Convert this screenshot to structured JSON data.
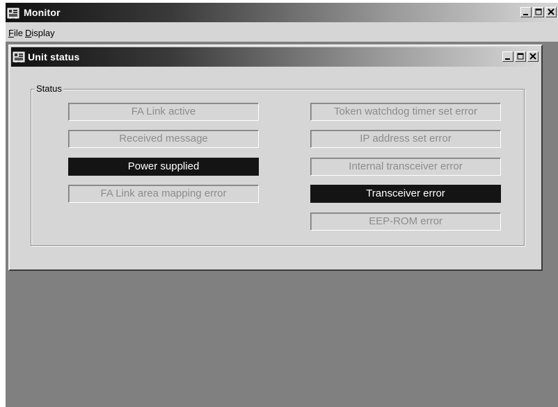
{
  "app": {
    "title": "Monitor"
  },
  "menu": {
    "items": [
      {
        "label": "File",
        "mnemonic": "F",
        "rest": "ile"
      },
      {
        "label": "Display",
        "mnemonic": "D",
        "rest": "isplay"
      }
    ]
  },
  "child_window": {
    "title": "Unit status"
  },
  "status_group": {
    "label": "Status",
    "left_column": [
      {
        "label": "FA Link active",
        "active": false
      },
      {
        "label": "Received message",
        "active": false
      },
      {
        "label": "Power supplied",
        "active": true
      },
      {
        "label": "FA Link area mapping error",
        "active": false
      }
    ],
    "right_column": [
      {
        "label": "Token watchdog timer set error",
        "active": false
      },
      {
        "label": "IP address set error",
        "active": false
      },
      {
        "label": "Internal transceiver error",
        "active": false
      },
      {
        "label": "Transceiver error",
        "active": true
      },
      {
        "label": "EEP-ROM error",
        "active": false
      }
    ]
  },
  "colors": {
    "active_bg": "#141414",
    "active_text": "#ffffff",
    "inactive_text": "#8c8c8c",
    "mdi_background": "#808080"
  },
  "icons": {
    "app_icon": "network-unit-icon",
    "minimize": "minimize-icon",
    "maximize": "maximize-icon",
    "close": "close-icon"
  }
}
